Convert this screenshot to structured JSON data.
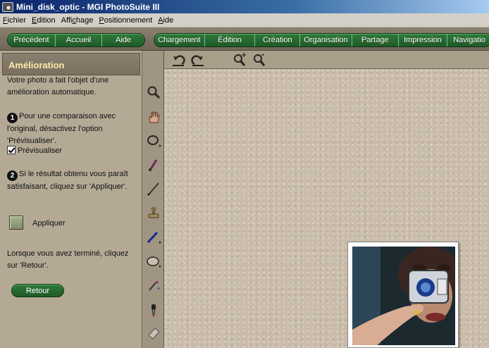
{
  "window": {
    "title": "Mini_disk_optic - MGI PhotoSuite III"
  },
  "menu": [
    {
      "label": "Fichier",
      "u": "F",
      "rest": "ichier"
    },
    {
      "label": "Edition",
      "u": "E",
      "rest": "dition"
    },
    {
      "label": "Affichage",
      "pre": "Affi",
      "u": "c",
      "rest": "hage"
    },
    {
      "label": "Positionnement",
      "u": "P",
      "rest": "ositionnement"
    },
    {
      "label": "Aide",
      "u": "A",
      "rest": "ide"
    }
  ],
  "nav": {
    "left": [
      "Précédent",
      "Accueil",
      "Aide"
    ],
    "right": [
      "Chargement",
      "Édition",
      "Création",
      "Organisation",
      "Partage",
      "Impression",
      "Navigatio"
    ]
  },
  "panel": {
    "title": "Amélioration",
    "intro": "Votre photo a fait l'objet d'une amélioration automatique.",
    "step1_num": "1",
    "step1_text": "Pour une comparaison avec l'original, désactivez l'option 'Prévisualiser'.",
    "preview_label": "Prévisualiser",
    "preview_checked": true,
    "step2_num": "2",
    "step2_text": "Si le résultat obtenu vous paraît satisfaisant, cliquez sur 'Appliquer'.",
    "apply_label": "Appliquer",
    "outro": "Lorsque vous avez terminé, cliquez sur 'Retour'.",
    "back_label": "Retour"
  },
  "tools": [
    "zoom-icon",
    "hand-icon",
    "lasso-icon",
    "brush-icon",
    "pen-icon",
    "stamp-icon",
    "line-icon",
    "ellipse-icon",
    "magic-wand-icon",
    "dropper-icon",
    "eraser-icon"
  ],
  "canvas_tools": [
    "rotate-left-icon",
    "rotate-right-icon",
    "zoom-in-icon",
    "zoom-out-icon"
  ],
  "colors": {
    "nav_green": "#2f7a3a",
    "panel_title": "#ffe9a8",
    "panel_bg": "#b3a995",
    "canvas_bg": "#c9bcaa"
  }
}
